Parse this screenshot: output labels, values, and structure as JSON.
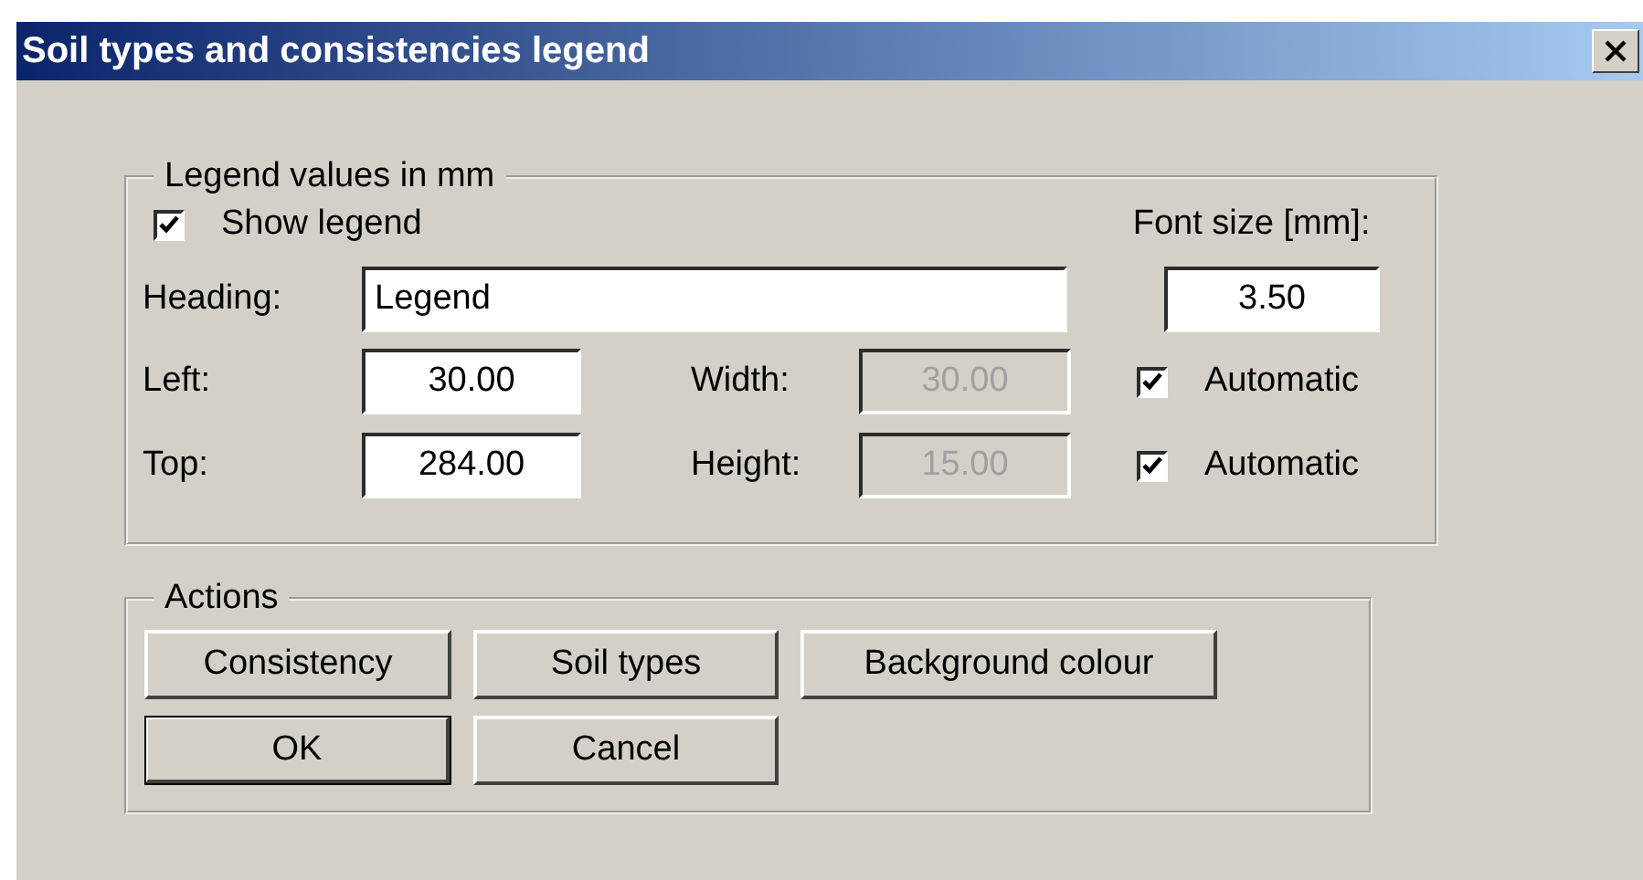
{
  "window": {
    "title": "Soil types and consistencies legend"
  },
  "legend_group": {
    "title": "Legend values in mm",
    "show_legend": {
      "label": "Show legend",
      "checked": true
    },
    "font_size": {
      "label": "Font size [mm]:",
      "value": "3.50"
    },
    "heading": {
      "label": "Heading:",
      "value": "Legend"
    },
    "rows": [
      {
        "label": "Left:",
        "value": "30.00",
        "size_label": "Width:",
        "size_value": "30.00",
        "size_disabled": true,
        "auto": {
          "label": "Automatic",
          "checked": true
        }
      },
      {
        "label": "Top:",
        "value": "284.00",
        "size_label": "Height:",
        "size_value": "15.00",
        "size_disabled": true,
        "auto": {
          "label": "Automatic",
          "checked": true
        }
      }
    ]
  },
  "actions": {
    "title": "Actions",
    "buttons": [
      {
        "label": "Consistency",
        "default": false
      },
      {
        "label": "Soil types",
        "default": false
      },
      {
        "label": "Background colour",
        "default": false
      },
      {
        "label": "OK",
        "default": true
      },
      {
        "label": "Cancel",
        "default": false
      }
    ]
  }
}
